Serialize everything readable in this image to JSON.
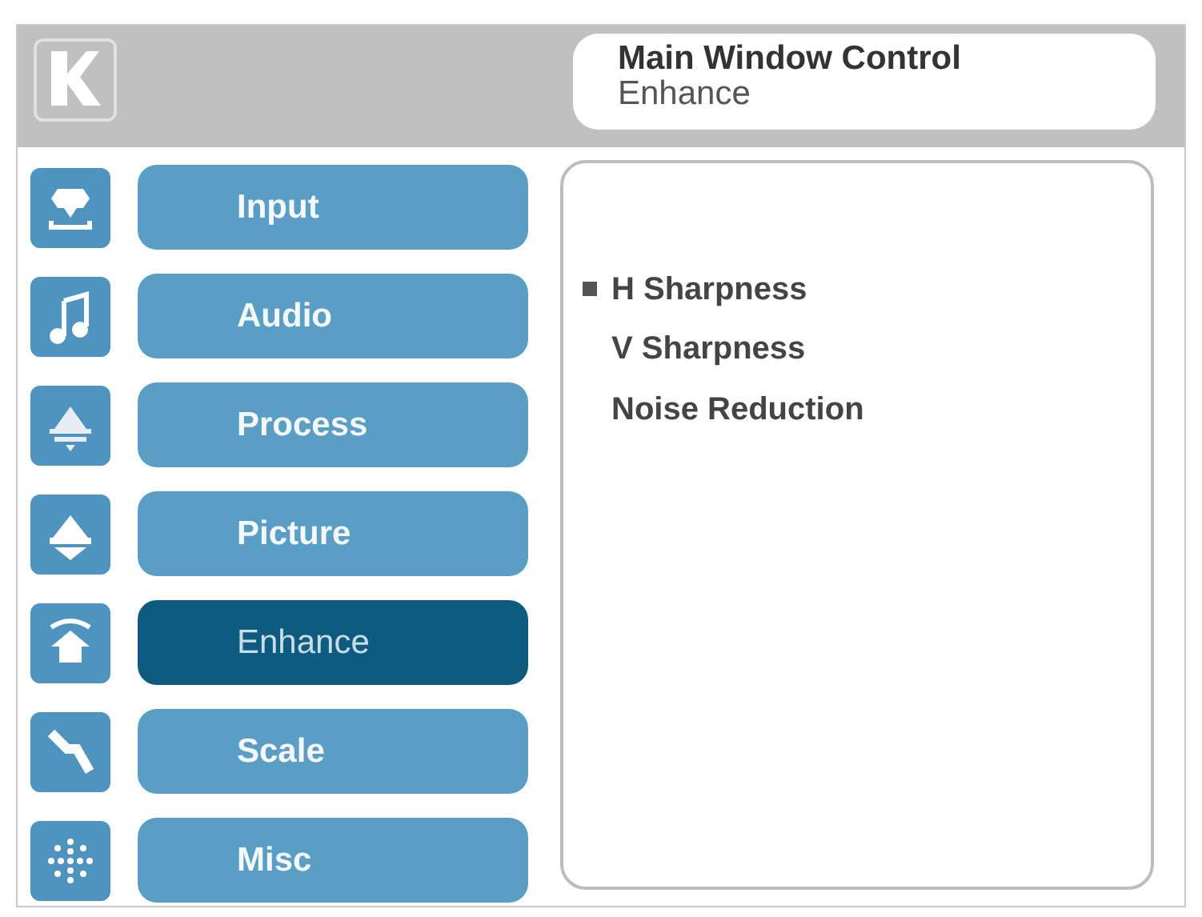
{
  "header": {
    "title": "Main Window Control",
    "subtitle": "Enhance"
  },
  "menu": [
    {
      "label": "Input",
      "selected": false
    },
    {
      "label": "Audio",
      "selected": false
    },
    {
      "label": "Process",
      "selected": false
    },
    {
      "label": "Picture",
      "selected": false
    },
    {
      "label": "Enhance",
      "selected": true
    },
    {
      "label": "Scale",
      "selected": false
    },
    {
      "label": "Misc",
      "selected": false
    }
  ],
  "options": [
    {
      "label": "H Sharpness",
      "selected": true
    },
    {
      "label": "V Sharpness",
      "selected": false
    },
    {
      "label": "Noise Reduction",
      "selected": false
    }
  ]
}
